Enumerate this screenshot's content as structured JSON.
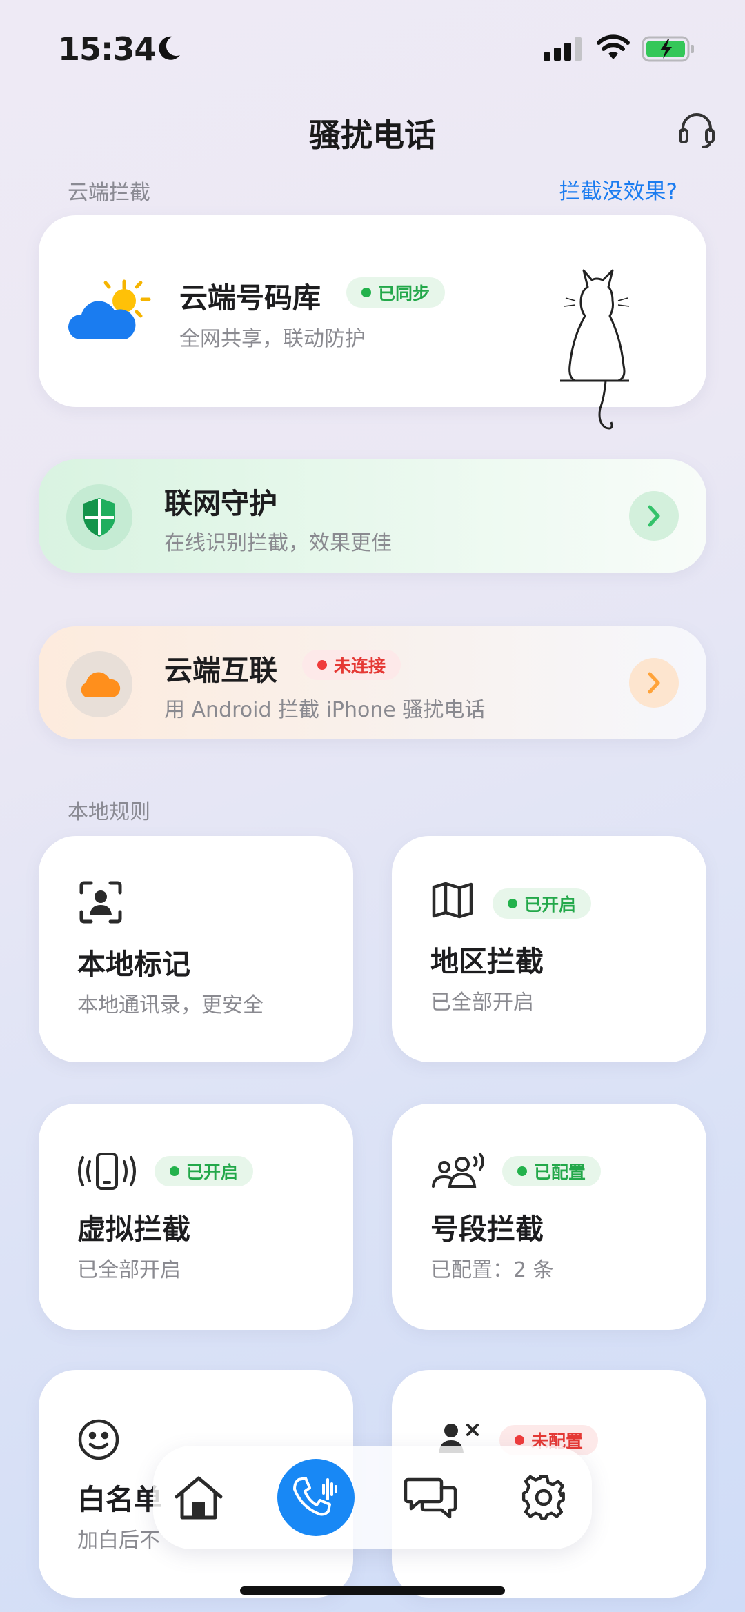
{
  "status_bar": {
    "time": "15:34"
  },
  "header": {
    "title": "骚扰电话"
  },
  "cloud_section": {
    "label": "云端拦截",
    "help_link": "拦截没效果?"
  },
  "cloud_library": {
    "title": "云端号码库",
    "badge": "已同步",
    "subtitle": "全网共享，联动防护"
  },
  "network_guard": {
    "title": "联网守护",
    "subtitle": "在线识别拦截，效果更佳"
  },
  "cloud_interconnect": {
    "title": "云端互联",
    "badge": "未连接",
    "subtitle": "用 Android 拦截 iPhone 骚扰电话"
  },
  "local_section": {
    "label": "本地规则"
  },
  "local_tiles": [
    {
      "title": "本地标记",
      "subtitle": "本地通讯录，更安全",
      "badge": ""
    },
    {
      "title": "地区拦截",
      "subtitle": "已全部开启",
      "badge": "已开启"
    },
    {
      "title": "虚拟拦截",
      "subtitle": "已全部开启",
      "badge": "已开启"
    },
    {
      "title": "号段拦截",
      "subtitle": "已配置：2 条",
      "badge": "已配置"
    },
    {
      "title": "白名单",
      "subtitle": "加白后不",
      "badge": ""
    },
    {
      "title": "",
      "subtitle": "",
      "badge": "未配置"
    }
  ],
  "colors": {
    "accent": "#1888f5",
    "green": "#23b24c",
    "red": "#ef3b3b",
    "link": "#1a7cf0"
  },
  "nav": [
    {
      "icon": "home-icon",
      "active": false
    },
    {
      "icon": "phone-wave-icon",
      "active": true
    },
    {
      "icon": "chat-icon",
      "active": false
    },
    {
      "icon": "gear-icon",
      "active": false
    }
  ]
}
